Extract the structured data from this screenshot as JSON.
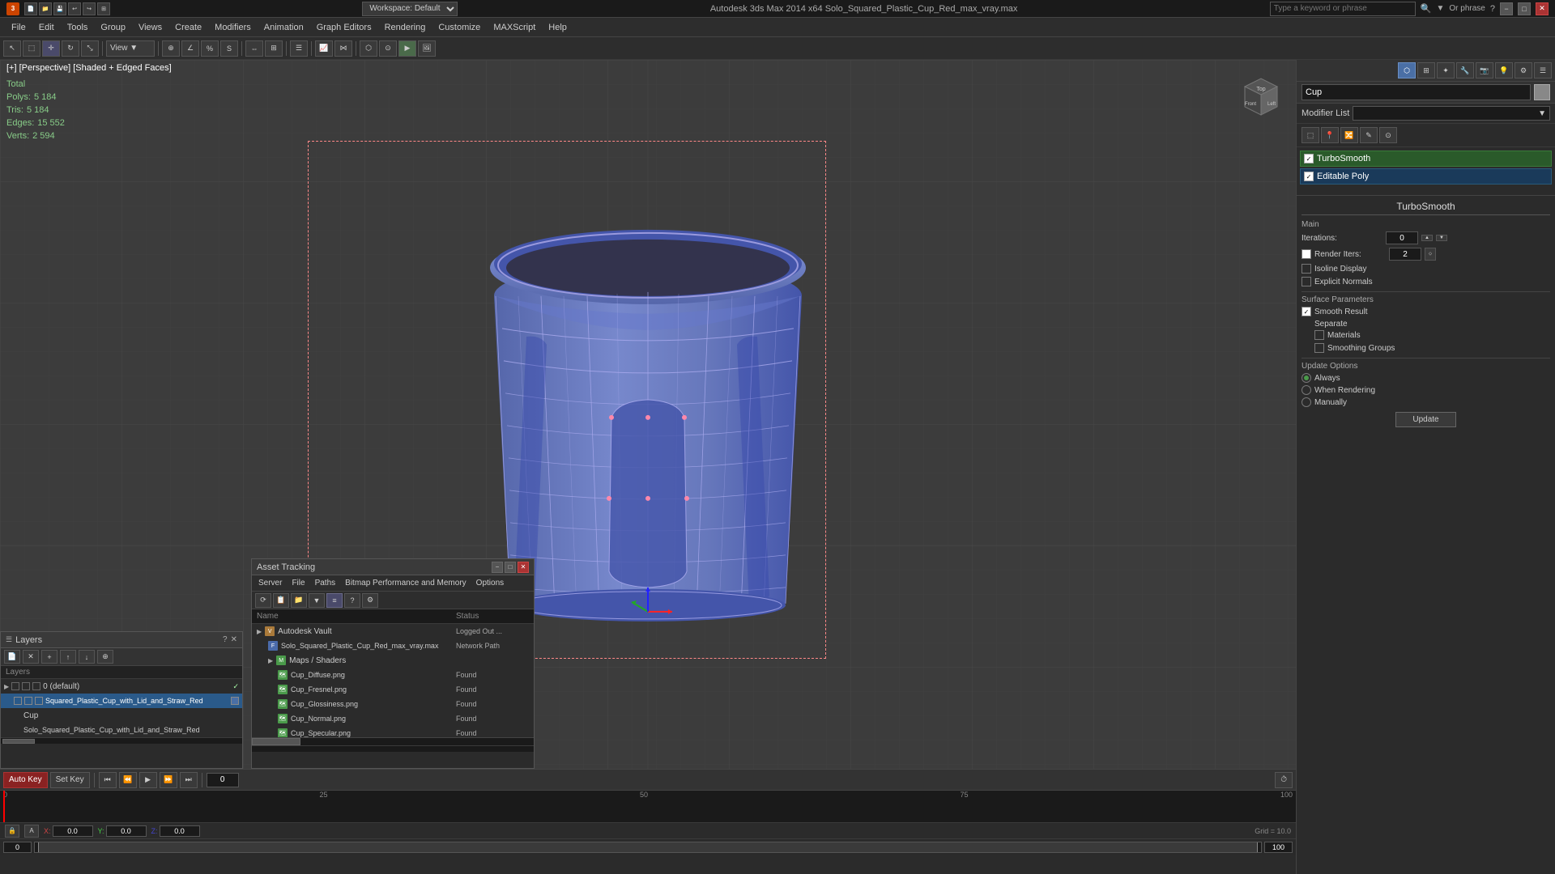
{
  "titlebar": {
    "app_name": "Autodesk 3ds Max 2014 x64",
    "file_name": "Solo_Squared_Plastic_Cup_Red_max_vray.max",
    "full_title": "Autodesk 3ds Max 2014 x64          Solo_Squared_Plastic_Cup_Red_max_vray.max",
    "min_label": "−",
    "max_label": "□",
    "close_label": "✕"
  },
  "toolbar": {
    "workspace_label": "Workspace: Default",
    "search_placeholder": "Type a keyword or phrase",
    "or_phrase_label": "Or phrase"
  },
  "menubar": {
    "items": [
      "File",
      "Edit",
      "Tools",
      "Group",
      "Views",
      "Create",
      "Modifiers",
      "Animation",
      "Graph Editors",
      "Rendering",
      "Customize",
      "MAXScript",
      "Help"
    ]
  },
  "viewport": {
    "label": "[+] [Perspective] [Shaded + Edged Faces]",
    "stats": {
      "polys_label": "Polys:",
      "polys_value": "5 184",
      "tris_label": "Tris:",
      "tris_value": "5 184",
      "edges_label": "Edges:",
      "edges_value": "15 552",
      "verts_label": "Verts:",
      "verts_value": "2 594",
      "total_label": "Total"
    }
  },
  "right_panel": {
    "object_name": "Cup",
    "modifier_list_label": "Modifier List",
    "modifiers": [
      {
        "name": "TurboSmooth",
        "type": "green"
      },
      {
        "name": "Editable Poly",
        "type": "blue"
      }
    ],
    "turbosmooth": {
      "title": "TurboSmooth",
      "main_label": "Main",
      "iterations_label": "Iterations:",
      "iterations_value": "0",
      "render_iters_label": "Render Iters:",
      "render_iters_value": "2",
      "isoline_display_label": "Isoline Display",
      "explicit_normals_label": "Explicit Normals",
      "surface_params_label": "Surface Parameters",
      "smooth_result_label": "Smooth Result",
      "smooth_result_checked": true,
      "separate_label": "Separate",
      "materials_label": "Materials",
      "smoothing_groups_label": "Smoothing Groups",
      "update_options_label": "Update Options",
      "always_label": "Always",
      "when_rendering_label": "When Rendering",
      "manually_label": "Manually",
      "update_btn_label": "Update"
    }
  },
  "layers_panel": {
    "title": "Layers",
    "question_label": "?",
    "close_label": "✕",
    "toolbar_buttons": [
      "+",
      "✕",
      "+",
      "↑",
      "↓",
      "⊕"
    ],
    "header_label": "Layers",
    "items": [
      {
        "name": "0 (default)",
        "level": 0,
        "checked": true,
        "selected": false
      },
      {
        "name": "Squared_Plastic_Cup_with_Lid_and_Straw_Red",
        "level": 1,
        "selected": true
      },
      {
        "name": "Cup",
        "level": 2,
        "selected": false
      },
      {
        "name": "Solo_Squared_Plastic_Cup_with_Lid_and_Straw_Red",
        "level": 2,
        "selected": false
      }
    ]
  },
  "asset_tracking": {
    "title": "Asset Tracking",
    "menubar": [
      "Server",
      "File",
      "Paths",
      "Bitmap Performance and Memory",
      "Options"
    ],
    "toolbar_buttons": [
      "⟳",
      "📋",
      "📁",
      "▼",
      "≡"
    ],
    "columns": {
      "name": "Name",
      "status": "Status"
    },
    "items": [
      {
        "name": "Autodesk Vault",
        "status": "Logged Out ...",
        "level": 0,
        "icon": "orange"
      },
      {
        "name": "Solo_Squared_Plastic_Cup_Red_max_vray.max",
        "status": "Network Path",
        "level": 1,
        "icon": "blue"
      },
      {
        "name": "Maps / Shaders",
        "status": "",
        "level": 1,
        "icon": "green"
      },
      {
        "name": "Cup_Diffuse.png",
        "status": "Found",
        "level": 2,
        "icon": "green"
      },
      {
        "name": "Cup_Fresnel.png",
        "status": "Found",
        "level": 2,
        "icon": "green"
      },
      {
        "name": "Cup_Glossiness.png",
        "status": "Found",
        "level": 2,
        "icon": "green"
      },
      {
        "name": "Cup_Normal.png",
        "status": "Found",
        "level": 2,
        "icon": "green"
      },
      {
        "name": "Cup_Specular.png",
        "status": "Found",
        "level": 2,
        "icon": "green"
      }
    ]
  },
  "icons": {
    "checkbox_checked": "✓",
    "radio_active": "●",
    "radio_inactive": "○",
    "expand": "▶",
    "collapse": "▼",
    "layer_icon": "📄",
    "folder_icon": "📁",
    "file_icon": "📄",
    "map_icon": "🗺",
    "refresh_icon": "⟳",
    "search_icon": "🔍",
    "help_icon": "?",
    "gear_icon": "⚙",
    "pin_icon": "📌",
    "lock_icon": "🔒",
    "eye_icon": "👁"
  }
}
